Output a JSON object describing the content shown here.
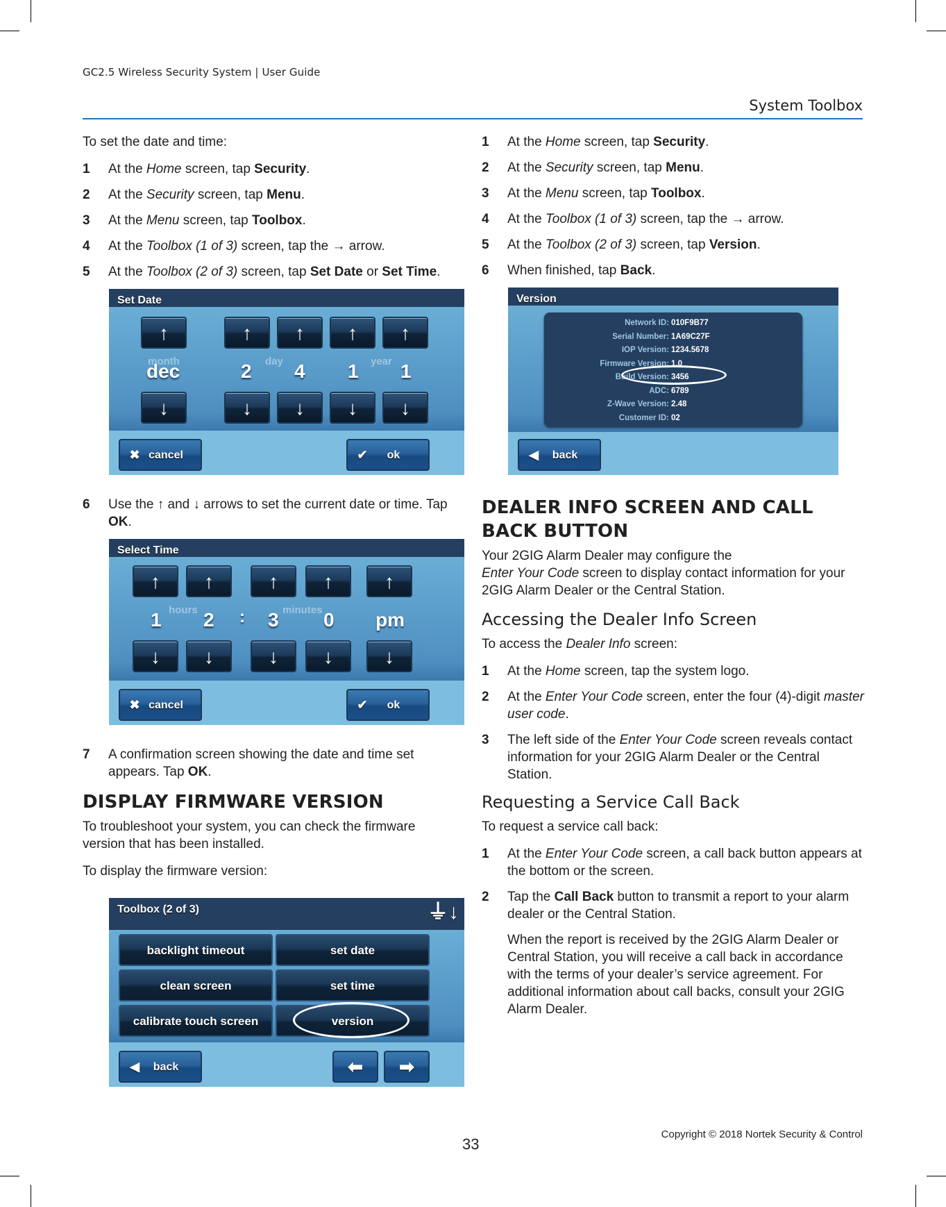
{
  "header": {
    "running_title": "GC2.5 Wireless Security System | User Guide",
    "section_title": "System Toolbox"
  },
  "left": {
    "intro": "To set the date and time:",
    "steps": [
      {
        "num": "1",
        "pre": "At the ",
        "em": "Home",
        "mid": " screen, tap ",
        "strong": "Security",
        "post": "."
      },
      {
        "num": "2",
        "pre": "At the ",
        "em": "Security",
        "mid": " screen, tap ",
        "strong": "Menu",
        "post": "."
      },
      {
        "num": "3",
        "pre": "At the ",
        "em": "Menu",
        "mid": " screen, tap ",
        "strong": "Toolbox",
        "post": "."
      },
      {
        "num": "4",
        "pre": "At the ",
        "em": "Toolbox (1 of 3)",
        "mid": " screen, tap the → arrow.",
        "strong": "",
        "post": ""
      },
      {
        "num": "5",
        "pre": "At the ",
        "em": "Toolbox (2 of 3)",
        "mid": " screen, tap ",
        "strong": "Set Date",
        "mid2": " or ",
        "strong2": "Set Time",
        "post": "."
      }
    ],
    "step6": {
      "num": "6",
      "pre": "Use the ↑ and ↓ arrows to set the current date or time. Tap ",
      "strong": "OK",
      "post": "."
    },
    "step7": {
      "num": "7",
      "pre": "A confirmation screen showing the date and time set appears. Tap ",
      "strong": "OK",
      "post": "."
    },
    "firmware_heading": "DISPLAY FIRMWARE VERSION",
    "firmware_para": "To troubleshoot your system, you can check the firmware version that has been installed.",
    "firmware_intro": "To display the firmware version:"
  },
  "set_date_screen": {
    "title": "Set Date",
    "labels": {
      "month": "month",
      "day": "day",
      "year": "year"
    },
    "values": {
      "month": "dec",
      "day": [
        "2",
        "4"
      ],
      "year": [
        "1",
        "1"
      ]
    },
    "up_glyph": "🡅",
    "cancel_label": "cancel",
    "ok_label": "ok"
  },
  "select_time_screen": {
    "title": "Select Time",
    "labels": {
      "hours": "hours",
      "minutes": "minutes"
    },
    "values": {
      "hours": [
        "1",
        "2"
      ],
      "separator": ":",
      "minutes": [
        "3",
        "0"
      ],
      "ampm": "pm"
    },
    "cancel_label": "cancel",
    "ok_label": "ok"
  },
  "toolbox_screen": {
    "title": "Toolbox (2 of 3)",
    "buttons": [
      "backlight timeout",
      "set date",
      "clean screen",
      "set time",
      "calibrate touch screen",
      "version"
    ],
    "highlighted": "version",
    "back_label": "back"
  },
  "right": {
    "steps": [
      {
        "num": "1",
        "pre": "At the ",
        "em": "Home",
        "mid": " screen, tap ",
        "strong": "Security",
        "post": "."
      },
      {
        "num": "2",
        "pre": "At the ",
        "em": "Security",
        "mid": " screen, tap ",
        "strong": "Menu",
        "post": "."
      },
      {
        "num": "3",
        "pre": "At the ",
        "em": "Menu",
        "mid": " screen, tap ",
        "strong": "Toolbox",
        "post": "."
      },
      {
        "num": "4",
        "pre": "At the ",
        "em": "Toolbox (1 of 3)",
        "mid": " screen, tap the → arrow.",
        "strong": "",
        "post": ""
      },
      {
        "num": "5",
        "pre": "At the ",
        "em": "Toolbox (2 of 3)",
        "mid": " screen, tap ",
        "strong": "Version",
        "post": "."
      },
      {
        "num": "6",
        "pre": "When finished, tap ",
        "em": "",
        "mid": "",
        "strong": "Back",
        "post": "."
      }
    ],
    "dealer_heading": "DEALER INFO SCREEN AND CALL BACK BUTTON",
    "dealer_para": {
      "pre": "Your 2GIG Alarm Dealer may configure the ",
      "em": "Enter Your Code",
      "post": " screen to display contact information for your 2GIG Alarm Dealer or the Central Station."
    },
    "access_heading": "Accessing the Dealer Info Screen",
    "access_intro": {
      "pre": "To access the ",
      "em": "Dealer Info",
      "post": " screen:"
    },
    "access_steps": [
      {
        "num": "1",
        "pre": "At the ",
        "em": "Home",
        "post": " screen, tap the system logo."
      },
      {
        "num": "2",
        "pre": "At the ",
        "em": "Enter Your Code",
        "post": " screen, enter the four (4)-digit ",
        "em2": "master user code",
        "post2": "."
      },
      {
        "num": "3",
        "pre": "The left side of the ",
        "em": "Enter Your Code",
        "post": " screen reveals contact information for your 2GIG Alarm Dealer or the Central Station."
      }
    ],
    "callback_heading": "Requesting a Service Call Back",
    "callback_intro": "To request a service call back:",
    "callback_steps": [
      {
        "num": "1",
        "pre": "At the ",
        "em": "Enter Your Code",
        "post": " screen, a call back button appears at the bottom or the screen."
      },
      {
        "num": "2",
        "pre": "Tap the ",
        "strong": "Call Back",
        "post": " button to transmit a report to your alarm dealer or the Central Station."
      }
    ],
    "callback_note": "When the report is received by the 2GIG Alarm Dealer or Central Station, you will receive a call back in accordance with the terms of your dealer’s service agreement. For additional information about call backs, consult your 2GIG Alarm Dealer."
  },
  "version_screen": {
    "title": "Version",
    "rows": [
      {
        "key": "Network ID:",
        "value": "010F9B77"
      },
      {
        "key": "Serial Number:",
        "value": "1A69C27F"
      },
      {
        "key": "IOP Version:",
        "value": "1234.5678"
      },
      {
        "key": "Firmware Version:",
        "value": "1.0"
      },
      {
        "key": "Build Version:",
        "value": "3456"
      },
      {
        "key": "ADC:",
        "value": "6789"
      },
      {
        "key": "Z-Wave Version:",
        "value": "2.48"
      },
      {
        "key": "Customer ID:",
        "value": "02"
      }
    ],
    "highlighted": "Firmware Version:",
    "back_label": "back"
  },
  "footer": {
    "copyright": "Copyright ©  2018 Nortek Security & Control",
    "page_number": "33"
  },
  "colors": {
    "accent_rule": "#1e73be",
    "screen_titlebar": "#243f5f",
    "screen_background": "#7dbde0"
  }
}
